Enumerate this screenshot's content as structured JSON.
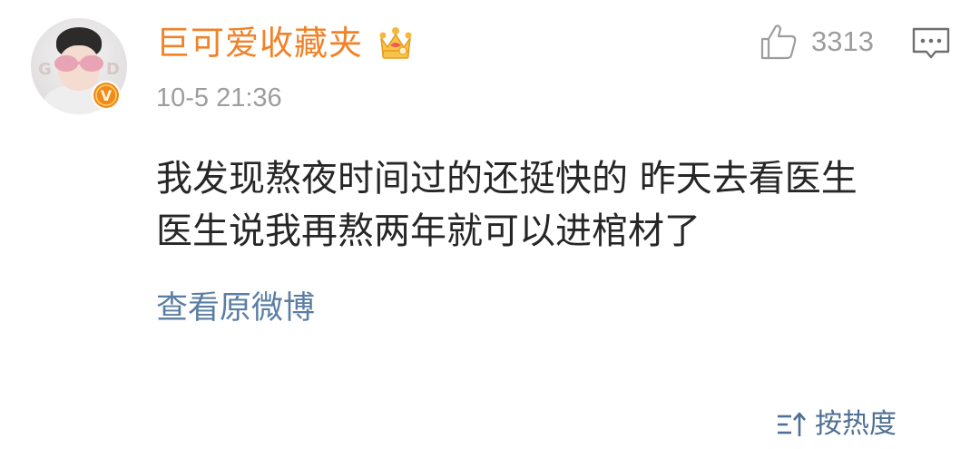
{
  "comment": {
    "author": {
      "name": "巨可爱收藏夹",
      "avatar_letters_left": "G",
      "avatar_letters_right": "D",
      "verified_badge": "V",
      "verified_icon": "verified-v-icon",
      "member_icon": "crown-icon"
    },
    "timestamp": "10-5 21:36",
    "like": {
      "icon": "thumbs-up-icon",
      "count": "3313"
    },
    "reply_icon": "comment-icon",
    "text_lines": [
      "我发现熬夜时间过的还挺快的 昨天去看医生",
      "医生说我再熬两年就可以进棺材了"
    ],
    "view_original_label": "查看原微博"
  },
  "sort": {
    "icon": "sort-icon",
    "label": "按热度"
  },
  "colors": {
    "username": "#f18228",
    "link": "#5a7ea3",
    "meta": "#9d9d9d",
    "text": "#262626",
    "badge": "#f08a1c"
  }
}
